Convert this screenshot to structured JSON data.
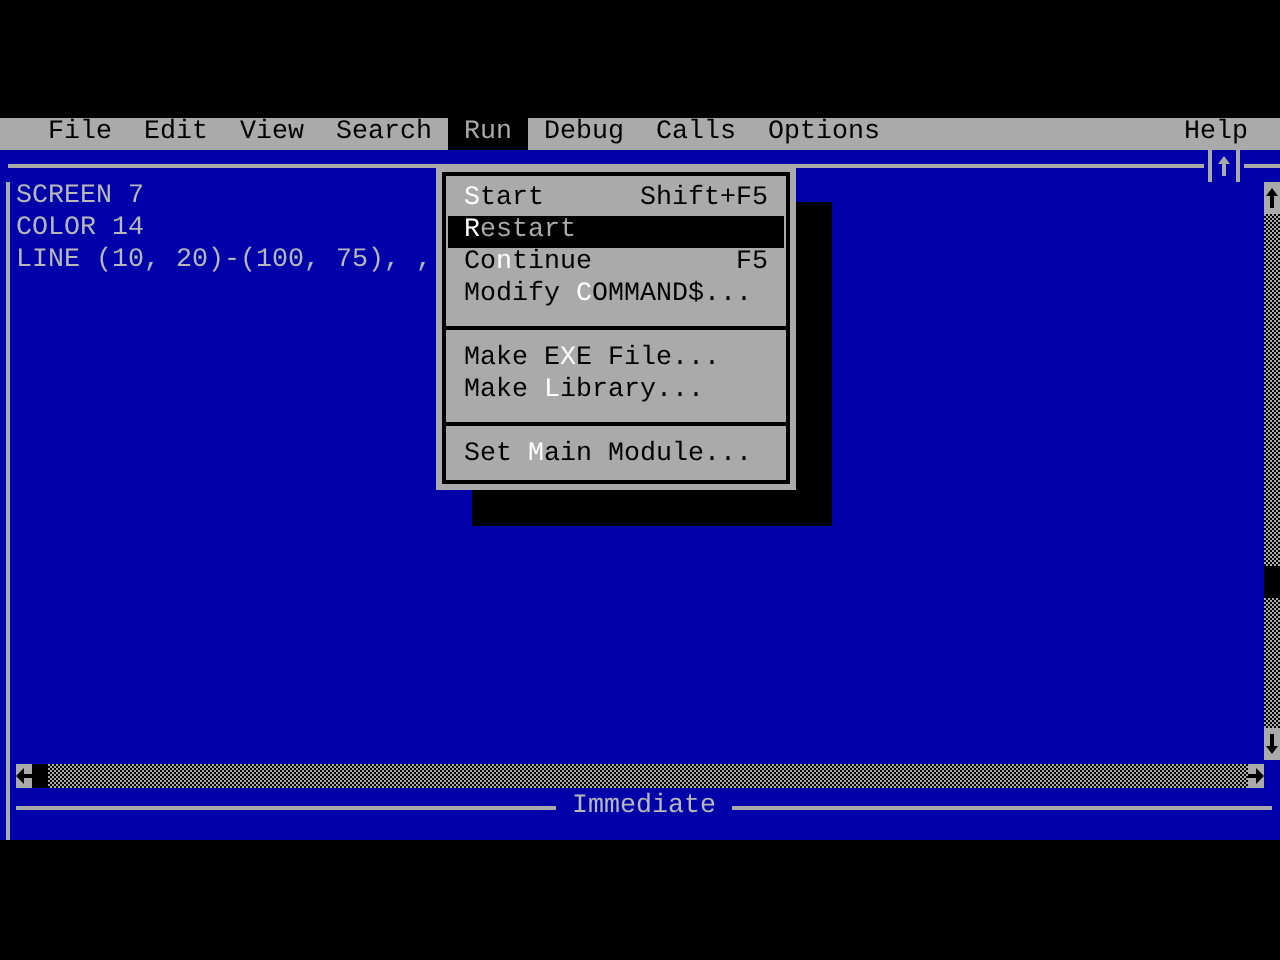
{
  "menubar": {
    "items": [
      {
        "label": "File",
        "selected": false
      },
      {
        "label": "Edit",
        "selected": false
      },
      {
        "label": "View",
        "selected": false
      },
      {
        "label": "Search",
        "selected": false
      },
      {
        "label": "Run",
        "selected": true
      },
      {
        "label": "Debug",
        "selected": false
      },
      {
        "label": "Calls",
        "selected": false
      },
      {
        "label": "Options",
        "selected": false
      }
    ],
    "help": {
      "label": "Help",
      "selected": false
    }
  },
  "editor": {
    "lines": [
      "SCREEN 7",
      "COLOR 14",
      "LINE (10, 20)-(100, 75), ,"
    ]
  },
  "immediate": {
    "title": "Immediate"
  },
  "run_menu": {
    "items": [
      {
        "kind": "item",
        "hotkey": "S",
        "suffix": "tart",
        "shortcut": "Shift+F5",
        "selected": false
      },
      {
        "kind": "item",
        "hotkey": "R",
        "suffix": "estart",
        "selected": true
      },
      {
        "kind": "item",
        "prefix": "Co",
        "hotkey": "n",
        "suffix": "tinue",
        "shortcut": "F5",
        "selected": false
      },
      {
        "kind": "item",
        "prefix": "Modify ",
        "hotkey": "C",
        "suffix": "OMMAND$...",
        "selected": false
      },
      {
        "kind": "separator"
      },
      {
        "kind": "item",
        "prefix": "Make E",
        "hotkey": "X",
        "suffix": "E File...",
        "selected": false
      },
      {
        "kind": "item",
        "prefix": "Make ",
        "hotkey": "L",
        "suffix": "ibrary...",
        "selected": false
      },
      {
        "kind": "separator"
      },
      {
        "kind": "item",
        "prefix": "Set ",
        "hotkey": "M",
        "suffix": "ain Module...",
        "selected": false
      }
    ]
  }
}
